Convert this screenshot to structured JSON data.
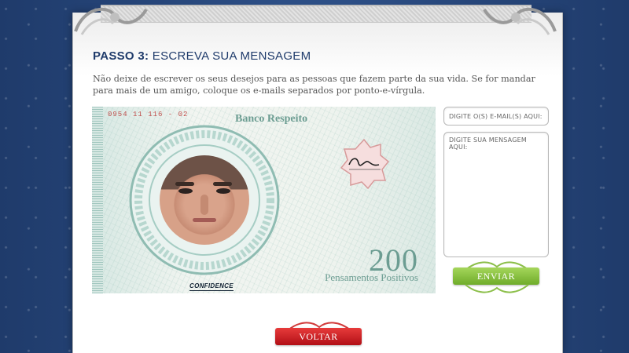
{
  "step": {
    "number_label": "PASSO 3:",
    "title": "ESCREVA SUA MENSAGEM",
    "instructions": "Não deixe de escrever os seus desejos para as pessoas que fazem parte da sua vida. Se for mandar para mais de um amigo, coloque os e-mails separados por ponto-e-vírgula."
  },
  "banknote": {
    "serial": "0954 11 116 - 02",
    "bank_name": "Banco Respeito",
    "value": "200",
    "value_label": "Pensamentos Positivos",
    "brand_logo": "CONFIDENCE",
    "signature": "Carlos"
  },
  "form": {
    "email_placeholder": "DIGITE O(S) E-MAIL(S) AQUI:",
    "email_value": "",
    "message_placeholder": "DIGITE SUA MENSAGEM AQUI:",
    "message_value": "",
    "send_label": "ENVIAR"
  },
  "nav": {
    "back_label": "VOLTAR"
  },
  "colors": {
    "title": "#1f3b6b",
    "note_ink": "#6c9d92",
    "serial": "#c0504d",
    "send_button": "#7fbf34",
    "back_button": "#c8141c",
    "background": "#2d4f86"
  }
}
